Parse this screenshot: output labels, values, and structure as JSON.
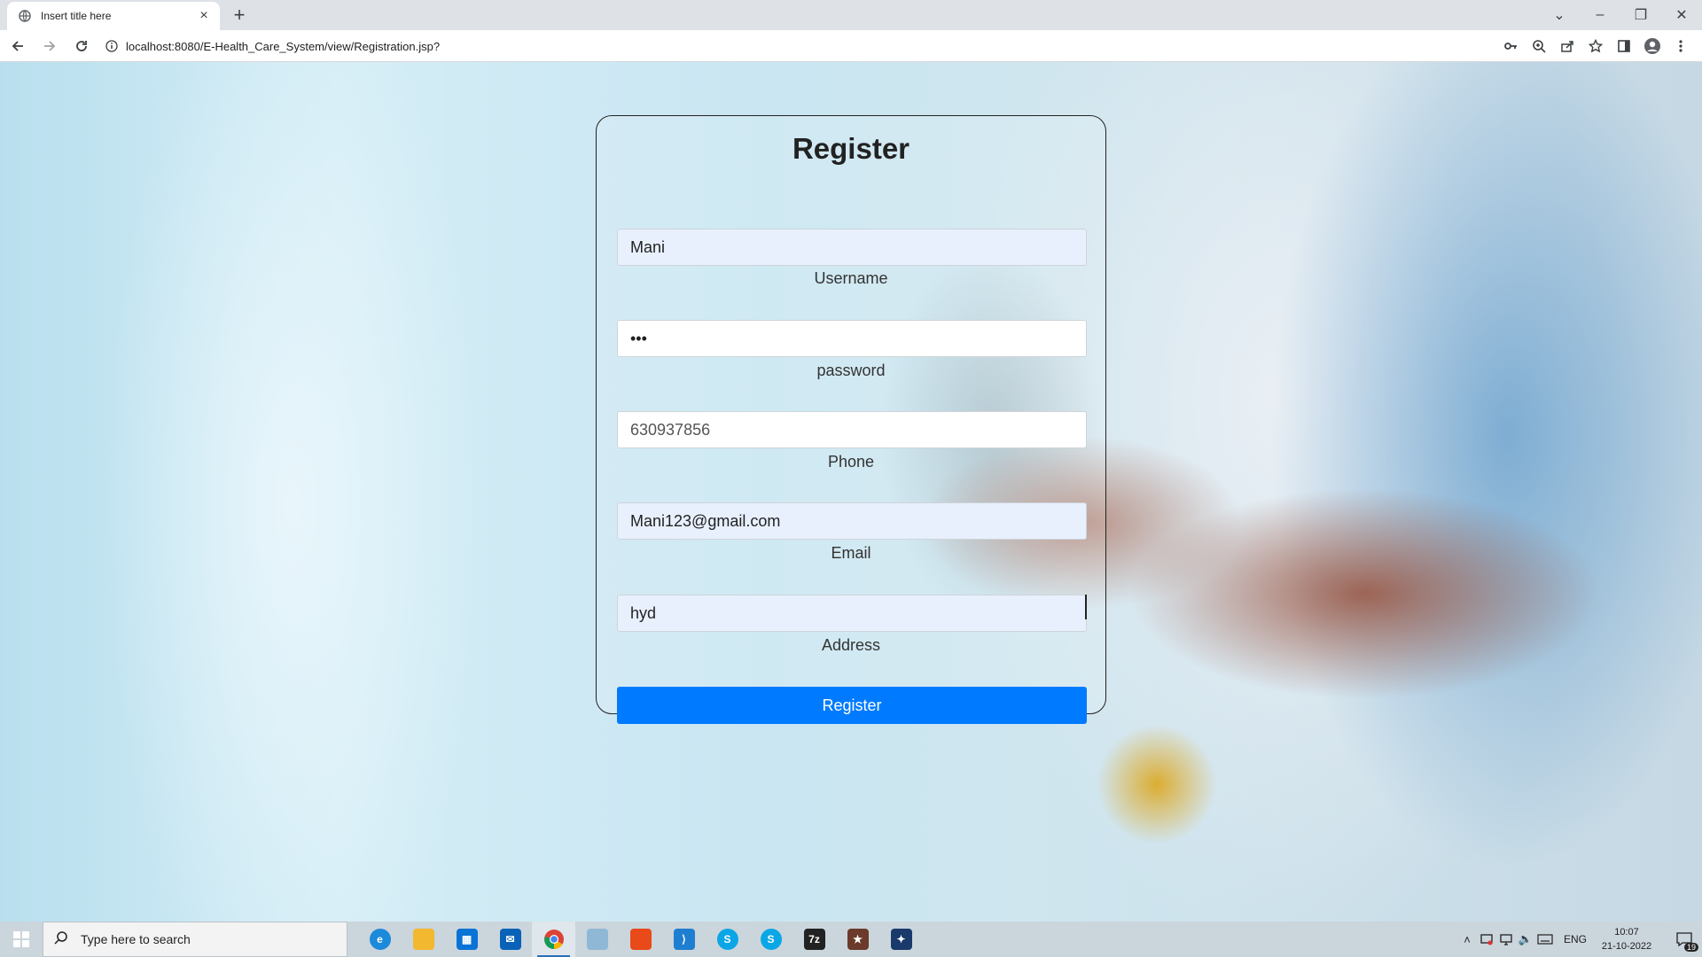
{
  "browser": {
    "tab_title": "Insert title here",
    "url": "localhost:8080/E-Health_Care_System/view/Registration.jsp?"
  },
  "form": {
    "title": "Register",
    "fields": [
      {
        "value": "Mani",
        "label": "Username"
      },
      {
        "value": "•••",
        "label": "password"
      },
      {
        "value": "630937856",
        "label": "Phone"
      },
      {
        "value": "Mani123@gmail.com",
        "label": "Email"
      },
      {
        "value": "hyd",
        "label": "Address"
      }
    ],
    "submit_label": "Register"
  },
  "taskbar": {
    "search_placeholder": "Type here to search",
    "language": "ENG",
    "time": "10:07",
    "date": "21-10-2022",
    "notification_count": "19",
    "apps": [
      "edge-icon",
      "file-explorer-icon",
      "store-icon",
      "mail-icon",
      "chrome-icon",
      "notepad-icon",
      "office-icon",
      "vscode-icon",
      "skype-icon",
      "skype-icon",
      "7zip-icon",
      "game-icon",
      "app-icon"
    ]
  },
  "colors": {
    "primary_button": "#007bff",
    "autofill_bg": "#e8f0fe"
  }
}
